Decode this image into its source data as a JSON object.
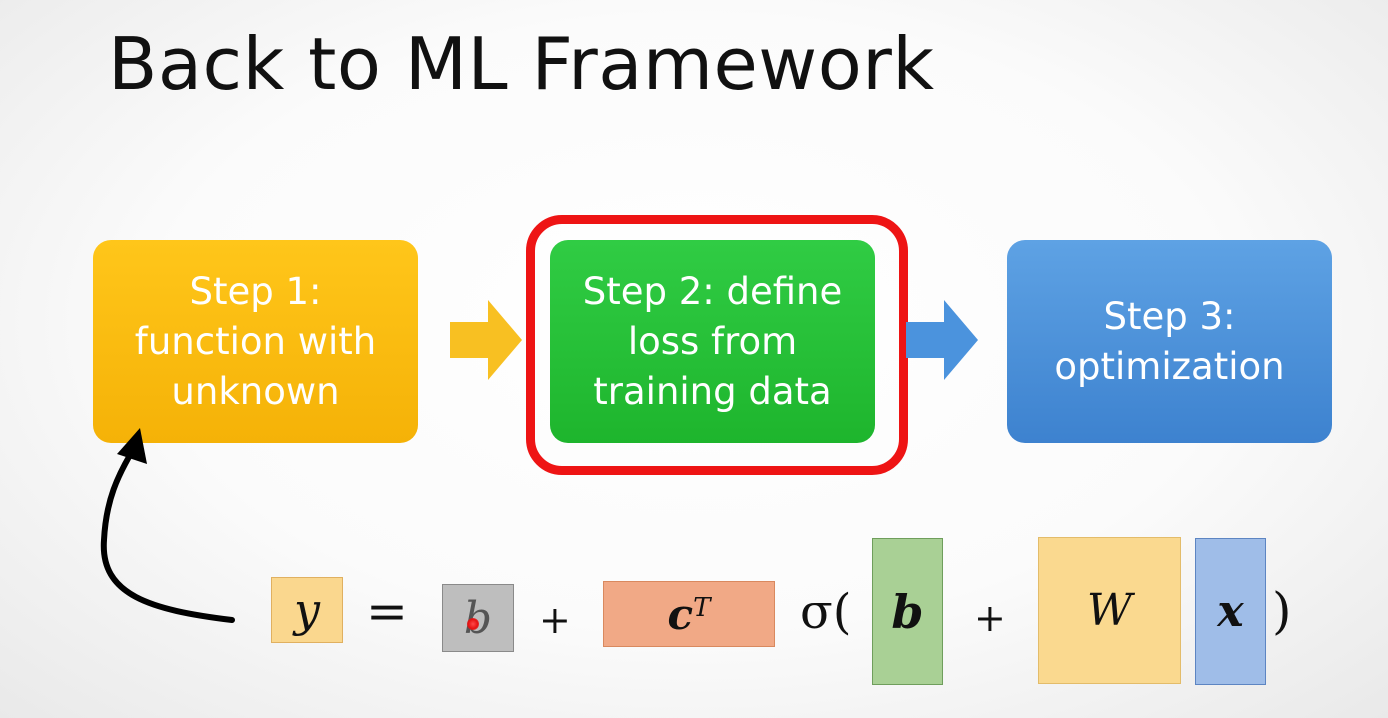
{
  "title": "Back to ML Framework",
  "steps": [
    {
      "text": "Step 1:\nfunction with\nunknown",
      "color": "#f9bc0f"
    },
    {
      "text": "Step 2: define\nloss from\ntraining data",
      "color": "#27c23a",
      "highlighted": true
    },
    {
      "text": "Step 3:\noptimization",
      "color": "#4a90dc"
    }
  ],
  "highlight_color": "#ee1414",
  "equation": {
    "y": "y",
    "equals": "=",
    "b1": "b",
    "plus1": "+",
    "c": "c",
    "c_sup": "T",
    "sigma_open": "σ(",
    "b2": "b",
    "plus2": "+",
    "W": "W",
    "x": "x",
    "close": ")"
  },
  "colors": {
    "y_box": "#fad78e",
    "b1_box": "#bebebe",
    "c_box": "#f1a986",
    "b2_box": "#a9d095",
    "W_box": "#fad98f",
    "x_box": "#9fbde8"
  }
}
